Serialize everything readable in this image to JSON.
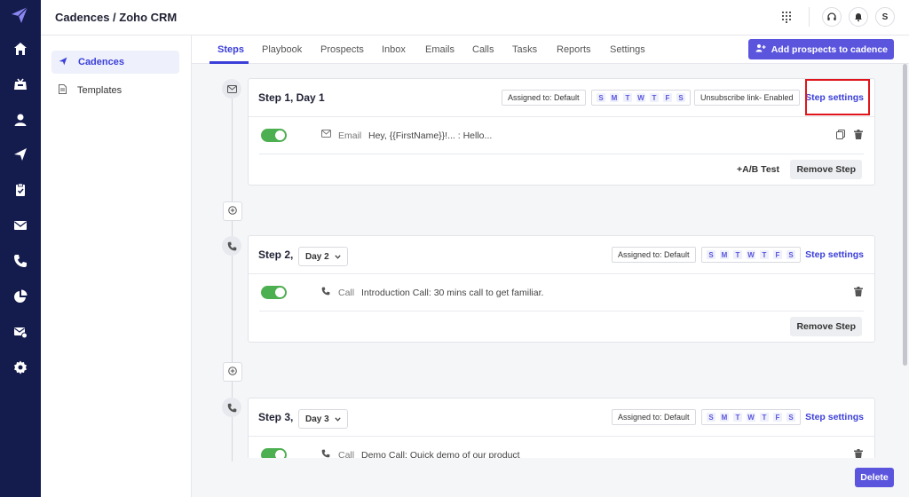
{
  "header": {
    "title": "Cadences / Zoho CRM",
    "avatar_initial": "S"
  },
  "rail": {
    "icons": [
      "home-icon",
      "inbox-icon",
      "user-icon",
      "send-icon",
      "clipboard-icon",
      "mail-icon",
      "phone-icon",
      "pie-chart-icon",
      "mail-settings-icon",
      "gear-icon"
    ]
  },
  "subnav": {
    "items": [
      {
        "label": "Cadences",
        "icon": "send-icon",
        "active": true
      },
      {
        "label": "Templates",
        "icon": "document-icon",
        "active": false
      }
    ]
  },
  "tabs": [
    "Steps",
    "Playbook",
    "Prospects",
    "Inbox",
    "Emails",
    "Calls",
    "Tasks",
    "Reports",
    "Settings"
  ],
  "add_prospects_label": "Add prospects to cadence",
  "steps": [
    {
      "title": "Step 1, Day 1",
      "assigned": "Assigned to: Default",
      "days": [
        "S",
        "M",
        "T",
        "W",
        "T",
        "F",
        "S"
      ],
      "unsubscribe": "Unsubscribe link- Enabled",
      "settings_label": "Step settings",
      "row_type": "Email",
      "row_text": "Hey, {{FirstName}}!... : Hello...",
      "ab_test": "+A/B Test",
      "remove": "Remove Step"
    },
    {
      "title": "Step 2,",
      "day_select": "Day 2",
      "assigned": "Assigned to: Default",
      "days": [
        "S",
        "M",
        "T",
        "W",
        "T",
        "F",
        "S"
      ],
      "settings_label": "Step settings",
      "row_type": "Call",
      "row_text": "Introduction Call: 30 mins call to get familiar.",
      "remove": "Remove Step"
    },
    {
      "title": "Step 3,",
      "day_select": "Day 3",
      "assigned": "Assigned to: Default",
      "days": [
        "S",
        "M",
        "T",
        "W",
        "T",
        "F",
        "S"
      ],
      "settings_label": "Step settings",
      "row_type": "Call",
      "row_text": "Demo Call: Quick demo of our product"
    }
  ],
  "delete_label": "Delete",
  "colors": {
    "accent": "#5b55de",
    "rail": "#141b4d",
    "toggle_on": "#4caf50",
    "highlight": "#e0151b"
  }
}
